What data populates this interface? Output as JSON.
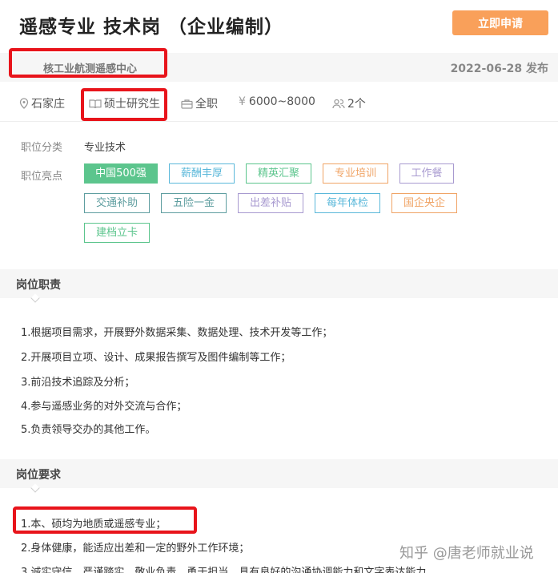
{
  "header": {
    "title": "遥感专业 技术岗 （企业编制）",
    "apply_label": "立即申请"
  },
  "org": {
    "name": "核工业航测遥感中心",
    "publish_date": "2022-06-28",
    "publish_suffix": "发布"
  },
  "meta": {
    "location": "石家庄",
    "degree": "硕士研究生",
    "job_type": "全职",
    "salary": "6000~8000",
    "headcount": "2个"
  },
  "category": {
    "label": "职位分类",
    "value": "专业技术"
  },
  "highlights": {
    "label": "职位亮点",
    "tags": [
      "中国500强",
      "薪酬丰厚",
      "精英汇聚",
      "专业培训",
      "工作餐",
      "交通补助",
      "五险一金",
      "出差补贴",
      "每年体检",
      "国企央企",
      "建档立卡"
    ]
  },
  "duties": {
    "title": "岗位职责",
    "items": [
      "1.根据项目需求，开展野外数据采集、数据处理、技术开发等工作；",
      "2.开展项目立项、设计、成果报告撰写及图件编制等工作；",
      "3.前沿技术追踪及分析；",
      "4.参与遥感业务的对外交流与合作；",
      "5.负责领导交办的其他工作。"
    ]
  },
  "requirements": {
    "title": "岗位要求",
    "items": [
      "1.本、硕均为地质或遥感专业；",
      "2.身体健康，能适应出差和一定的野外工作环境；",
      "3.诚实守信，严谨踏实，敬业负责，勇于担当，具有良好的沟通协调能力和文字表达能力"
    ]
  },
  "watermark": "知乎 @唐老师就业说",
  "colors": {
    "accent": "#f9a05a",
    "highlight_box": "#e8141b",
    "tag_green": "#5cc58d",
    "tag_blue": "#5bb8da",
    "tag_orange": "#f0a466",
    "tag_purple": "#a89ad0",
    "tag_teal": "#5f9ea0"
  }
}
